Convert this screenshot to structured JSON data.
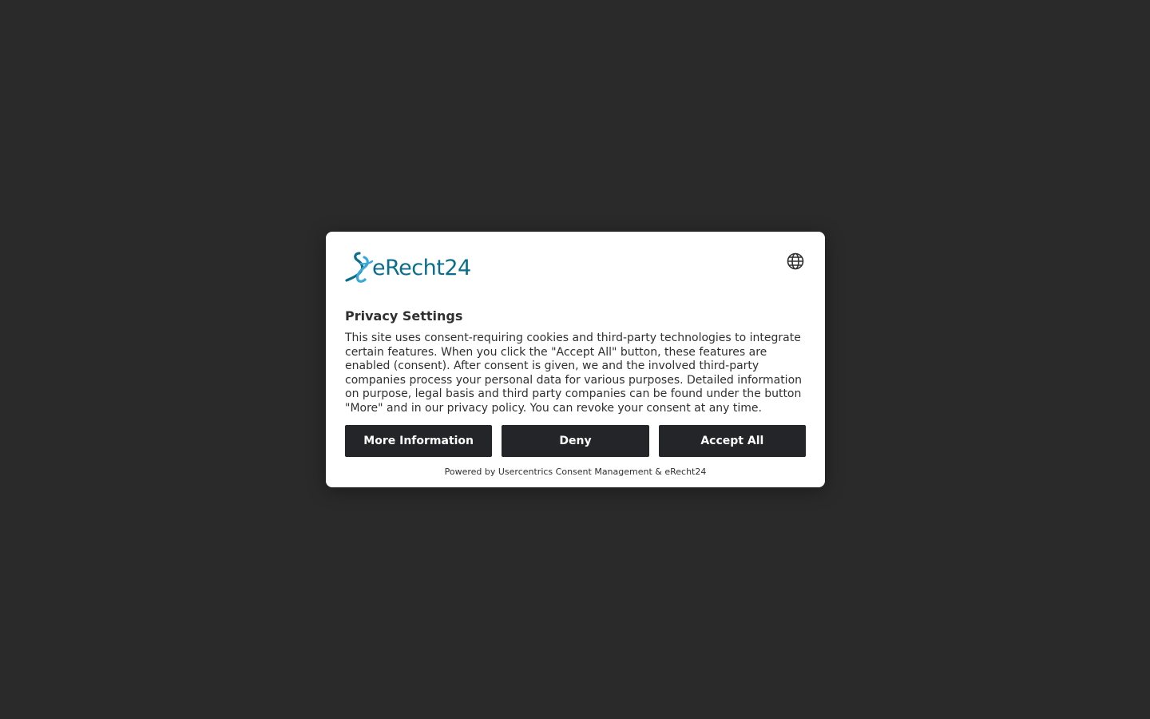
{
  "brand": {
    "name": "eRecht24",
    "primary_color": "#0a6e8c",
    "accent_color": "#3aa8d8"
  },
  "header": {
    "language_icon": "globe-icon"
  },
  "dialog": {
    "title": "Privacy Settings",
    "description": "This site uses consent-requiring cookies and third-party technologies to integrate certain features. When you click the \"Accept All\" button, these features are enabled (consent). After consent is given, we and the involved third-party companies process your personal data for various purposes. Detailed information on purpose, legal basis and third party companies can be found under the button \"More\" and in our privacy policy. You can revoke your consent at any time.",
    "buttons": {
      "more_info": "More Information",
      "deny": "Deny",
      "accept_all": "Accept All"
    },
    "button_color": "#232529",
    "footer": "Powered by Usercentrics Consent Management & eRecht24"
  }
}
